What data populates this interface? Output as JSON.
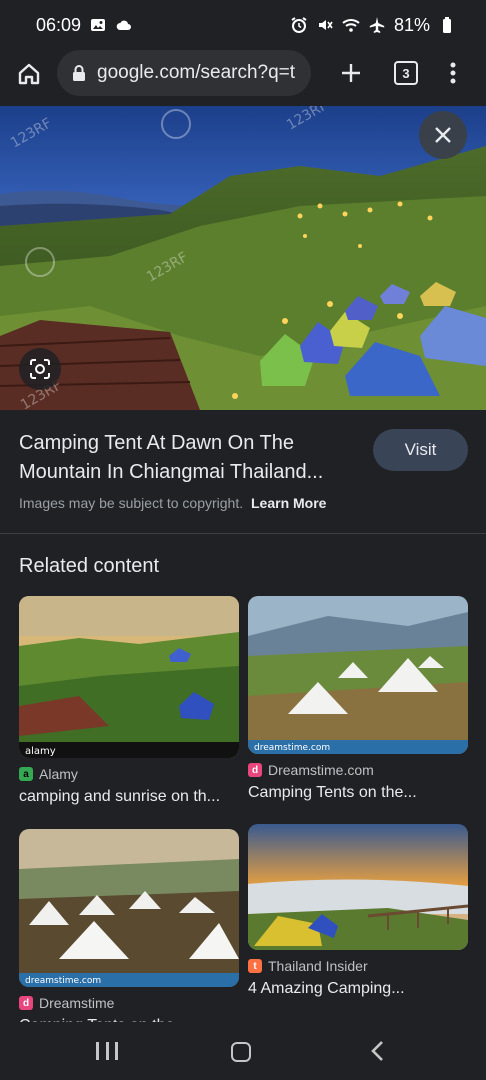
{
  "status": {
    "time": "06:09",
    "battery": "81%",
    "icons_left": [
      "image-icon",
      "cloud-icon"
    ],
    "icons_right": [
      "alarm-icon",
      "mute-icon",
      "wifi-icon",
      "airplane-icon",
      "battery-icon"
    ]
  },
  "browser": {
    "url": "google.com/search?q=t",
    "tab_count": "3"
  },
  "viewer": {
    "title": "Camping Tent At Dawn On The Mountain In Chiangmai Thailand...",
    "visit_label": "Visit",
    "copyright_text": "Images may be subject to copyright.",
    "learn_more": "Learn More",
    "watermark": "123RF"
  },
  "related": {
    "heading": "Related content",
    "items": [
      {
        "source": "Alamy",
        "title": "camping and sunrise on th...",
        "favicon_color": "#34a853",
        "favicon_letter": "a"
      },
      {
        "source": "Dreamstime.com",
        "title": "Camping Tents on the...",
        "favicon_color": "#e8467c",
        "favicon_letter": "d"
      },
      {
        "source": "Dreamstime",
        "title": "Camping Tents on the...",
        "favicon_color": "#e8467c",
        "favicon_letter": "d"
      },
      {
        "source": "Thailand Insider",
        "title": "4 Amazing Camping...",
        "favicon_color": "#ff7043",
        "favicon_letter": "t"
      }
    ],
    "thumb_watermarks": [
      "alamy",
      "dreamstime.com",
      "dreamstime.com"
    ]
  },
  "colors": {
    "background": "#202124",
    "visit_button": "#394457",
    "muted_text": "#9aa0a6"
  }
}
